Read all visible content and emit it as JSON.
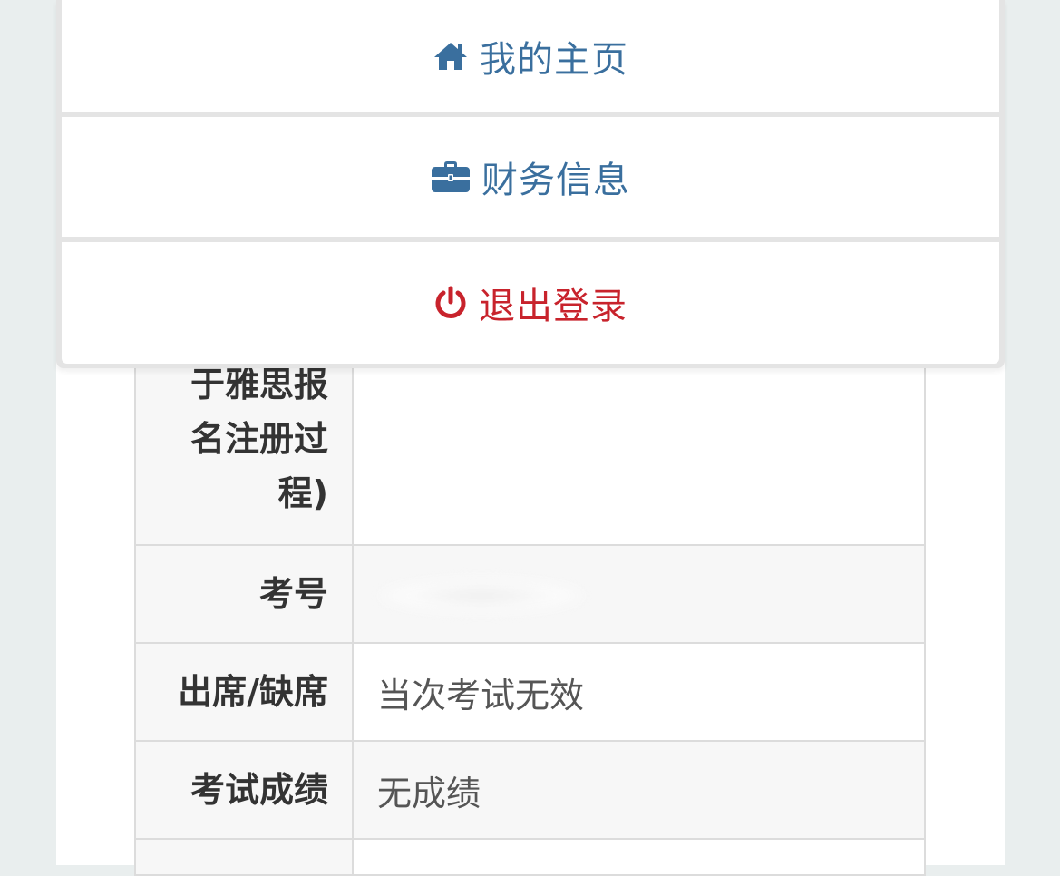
{
  "menu": {
    "items": [
      {
        "label": "我的主页",
        "icon": "home-icon",
        "color": "#3a6f9e"
      },
      {
        "label": "财务信息",
        "icon": "briefcase-icon",
        "color": "#3a6f9e"
      },
      {
        "label": "退出登录",
        "icon": "power-icon",
        "color": "#c8232c"
      }
    ]
  },
  "record": {
    "rows": [
      {
        "label": "于雅思报名注册过程)",
        "value": ""
      },
      {
        "label": "考号",
        "value": ""
      },
      {
        "label": "出席/缺席",
        "value": "当次考试无效"
      },
      {
        "label": "考试成绩",
        "value": "无成绩"
      }
    ]
  }
}
